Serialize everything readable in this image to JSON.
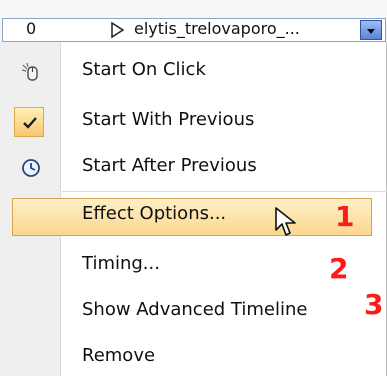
{
  "animation_row": {
    "order": "0",
    "name": "elytis_trelovaporo_...",
    "dropdown_icon": "chevron-down-icon",
    "play_icon": "play-triangle-icon"
  },
  "menu": {
    "items": [
      {
        "label": "Start On Click",
        "icon": "mouse-click-icon"
      },
      {
        "label": "Start With Previous",
        "icon": "checkmark-icon",
        "checked": true
      },
      {
        "label": "Start After Previous",
        "icon": "clock-icon"
      },
      {
        "label": "Effect Options...",
        "highlighted": true
      },
      {
        "label": "Timing..."
      },
      {
        "label": "Show Advanced Timeline"
      },
      {
        "label": "Remove"
      }
    ]
  },
  "annotations": {
    "one": "1",
    "two": "2",
    "three": "3"
  },
  "colors": {
    "highlight": "#fbd78e",
    "badge": "#ff1a1a",
    "accent_blue": "#5c84d8"
  }
}
